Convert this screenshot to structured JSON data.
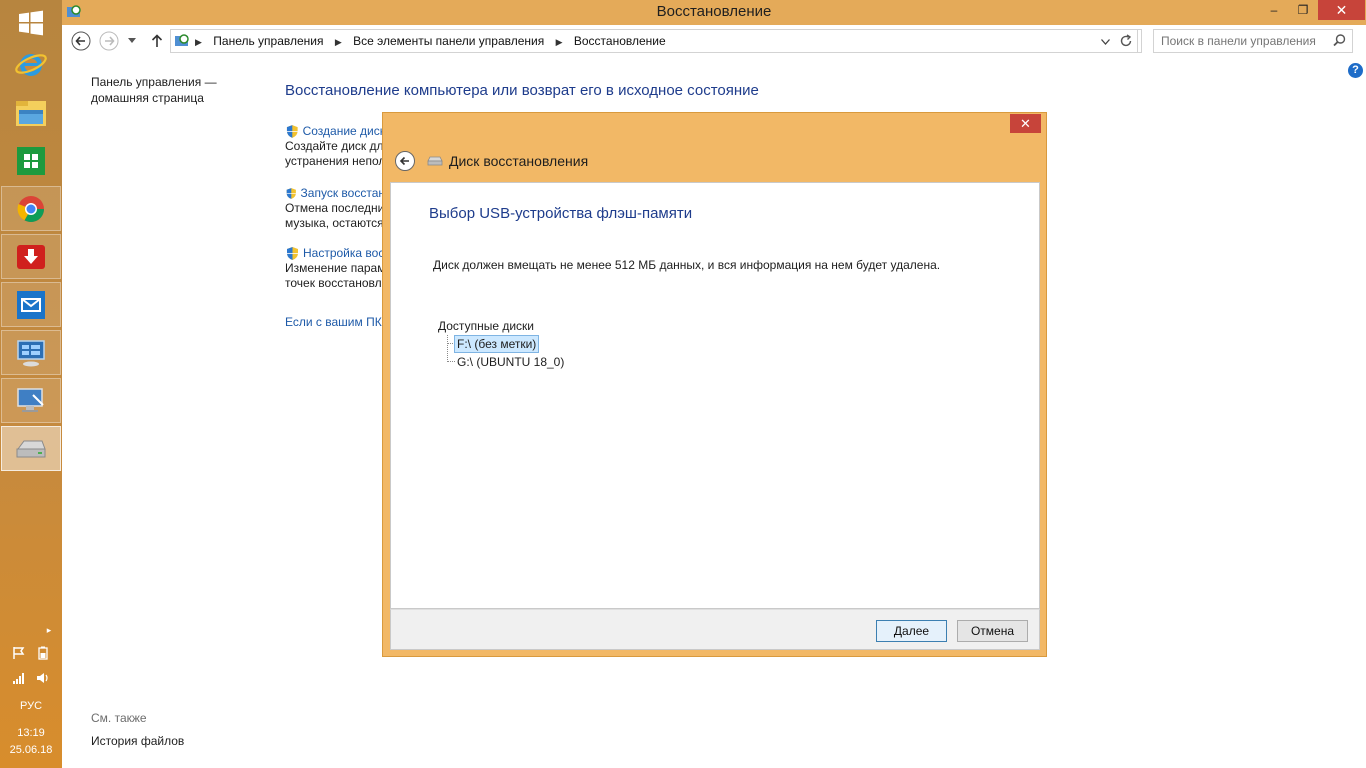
{
  "window": {
    "title": "Восстановление",
    "controls": {
      "minimize": "–",
      "maximize": "❐",
      "close": "✕"
    }
  },
  "navigation": {
    "back_icon": "back-arrow-icon",
    "forward_icon": "forward-arrow-icon",
    "breadcrumbs": [
      "Панель управления",
      "Все элементы панели управления",
      "Восстановление"
    ],
    "search_placeholder": "Поиск в панели управления"
  },
  "sidebar": {
    "home_link": "Панель управления — домашняя страница",
    "see_also_label": "См. также",
    "see_also_items": [
      "История файлов"
    ]
  },
  "main": {
    "title": "Восстановление компьютера или возврат его в исходное состояние",
    "tasks": [
      {
        "link": "Создание диск",
        "desc_lines": [
          "Создайте диск для",
          "устранения непол"
        ]
      },
      {
        "link": "Запуск восстан",
        "desc_lines": [
          "Отмена последни",
          "музыка, остаются"
        ]
      },
      {
        "link": "Настройка вос",
        "desc_lines": [
          "Изменение парам",
          "точек восстановл"
        ]
      }
    ],
    "bottom_link": "Если с вашим ПК",
    "help_icon": "?"
  },
  "dialog": {
    "title": "Диск восстановления",
    "step_title": "Выбор USB-устройства флэш-памяти",
    "instruction": "Диск должен вмещать не менее 512 МБ данных, и вся информация на нем будет удалена.",
    "drives_label": "Доступные диски",
    "drives": [
      {
        "label": "F:\\ (без метки)",
        "selected": true
      },
      {
        "label": "G:\\ (UBUNTU 18_0)",
        "selected": false
      }
    ],
    "buttons": {
      "next": "Далее",
      "cancel": "Отмена"
    },
    "close_icon": "✕"
  },
  "taskbar": {
    "apps": [
      "start-icon",
      "internet-explorer-icon",
      "file-explorer-icon",
      "store-icon",
      "chrome-icon",
      "download-icon",
      "mail-icon",
      "control-panel-icon",
      "remote-desktop-icon",
      "recovery-drive-icon"
    ],
    "language": "РУС",
    "time": "13:19",
    "date": "25.06.18"
  },
  "colors": {
    "accent": "#e4aa59",
    "taskbar": "#c58a3f",
    "link": "#1e5aa8",
    "heading": "#1e3c8c",
    "close": "#c7443a"
  }
}
